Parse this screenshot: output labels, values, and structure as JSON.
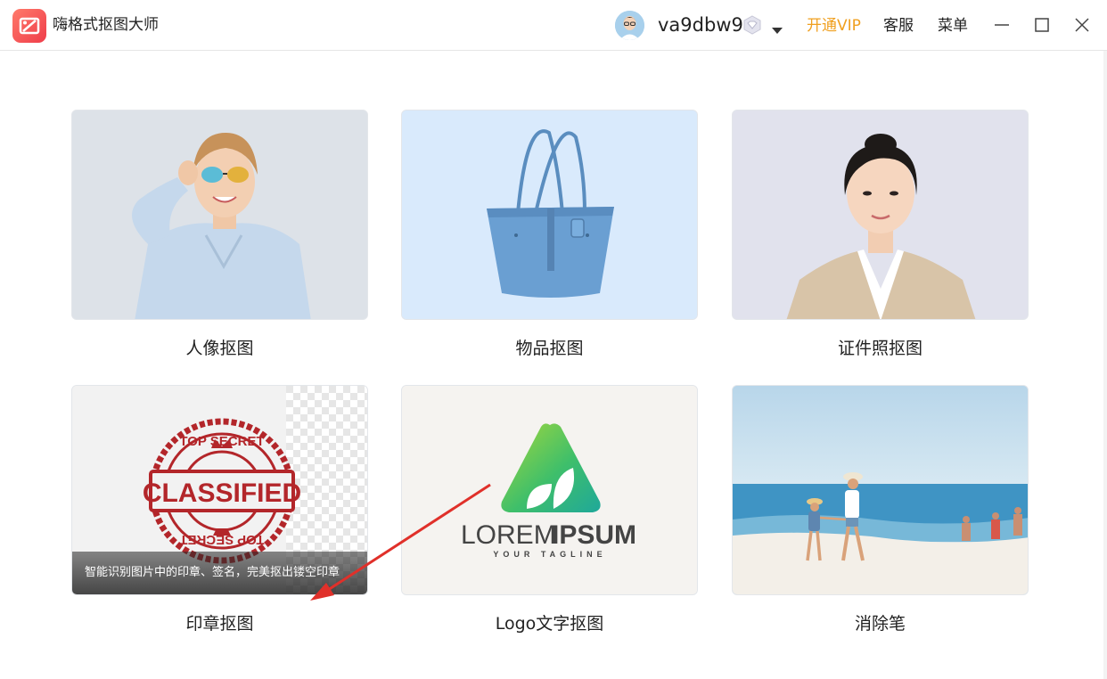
{
  "app": {
    "title": "嗨格式抠图大师"
  },
  "header": {
    "username": "va9dbw9",
    "open_vip": "开通VIP",
    "service": "客服",
    "menu": "菜单"
  },
  "cards": [
    {
      "label": "人像抠图"
    },
    {
      "label": "物品抠图"
    },
    {
      "label": "证件照抠图"
    },
    {
      "label": "印章抠图",
      "tip": "智能识别图片中的印章、签名，完美抠出镂空印章",
      "stamp_top": "TOP SECRET",
      "stamp_main": "CLASSIFIED",
      "stamp_bottom": "TOP SECRET"
    },
    {
      "label": "Logo文字抠图",
      "logo_main_light": "LOREM",
      "logo_main_bold": "IPSUM",
      "logo_tagline": "YOUR TAGLINE"
    },
    {
      "label": "消除笔"
    }
  ],
  "colors": {
    "accent_vip": "#f0a020",
    "stamp_red": "#b3262a",
    "arrow_red": "#e0302a",
    "logo_green": "#3fbf6a"
  }
}
